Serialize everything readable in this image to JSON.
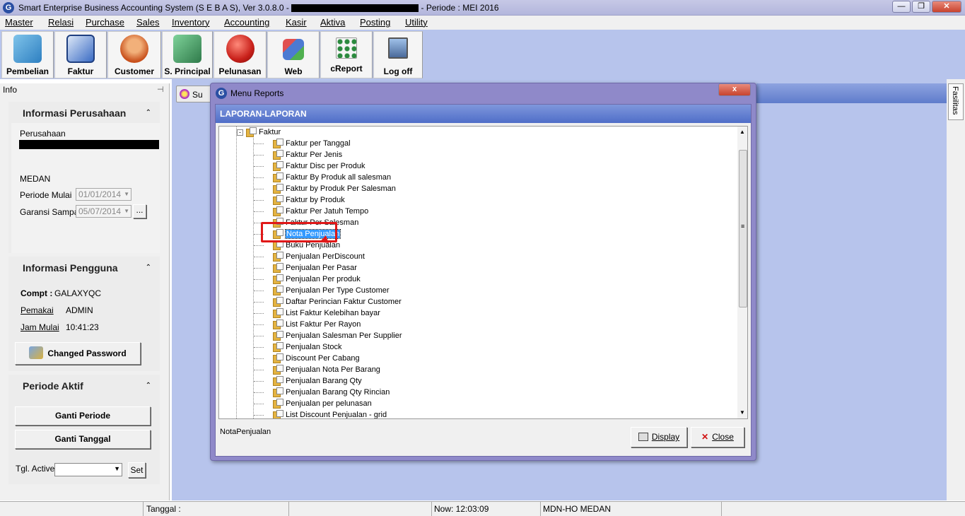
{
  "window": {
    "title_prefix": "Smart Enterprise Business Accounting System (S E B A S), Ver 3.0.8.0 -",
    "title_suffix": "- Periode : MEI  2016",
    "app_icon": "G"
  },
  "menu": [
    "Master",
    "Relasi",
    "Purchase",
    "Sales",
    "Inventory",
    "Accounting",
    "Kasir",
    "Aktiva",
    "Posting",
    "Utility"
  ],
  "toolbar": [
    {
      "label": "Pembelian",
      "icon": "building-chart-icon",
      "color": "#4aa3d8"
    },
    {
      "label": "Faktur",
      "icon": "invoice-icon",
      "color": "#3b6cc4"
    },
    {
      "label": "Customer",
      "icon": "headset-person-icon",
      "color": "#d2642a"
    },
    {
      "label": "S. Principal",
      "icon": "money-icon",
      "color": "#3c9a5a"
    },
    {
      "label": "Pelunasan",
      "icon": "red-globe-icon",
      "color": "#c8201a"
    },
    {
      "label": "Web",
      "icon": "web-blocks-icon",
      "color": "#4c7ad2"
    },
    {
      "label": "cReport",
      "icon": "creport-icon",
      "color": "#2b8a3e"
    },
    {
      "label": "Log off",
      "icon": "computer-logoff-icon",
      "color": "#5b6c8c"
    }
  ],
  "sidebar": {
    "header": "Info",
    "company": {
      "title": "Informasi Perusahaan",
      "label": "Perusahaan",
      "city": "MEDAN",
      "periode_mulai_label": "Periode Mulai",
      "periode_mulai": "01/01/2014",
      "garansi_label": "Garansi Sampai",
      "garansi": "05/07/2014",
      "browse": "..."
    },
    "user": {
      "title": "Informasi Pengguna",
      "compt_label": "Compt :",
      "compt": "GALAXYQC",
      "pemakai_label": "Pemakai",
      "pemakai": "ADMIN",
      "jam_label": "Jam Mulai",
      "jam": "10:41:23",
      "change_pw": "Changed Password"
    },
    "periode": {
      "title": "Periode Aktif",
      "ganti_periode": "Ganti Periode",
      "ganti_tanggal": "Ganti Tanggal",
      "tgl_label": "Tgl. Active",
      "set": "Set"
    }
  },
  "background_tab": "Su",
  "right_tab": "Fasilitas",
  "dialog": {
    "title": "Menu Reports",
    "header": "LAPORAN-LAPORAN",
    "root": "Faktur",
    "items": [
      "Faktur per Tanggal",
      "Faktur Per Jenis",
      "Faktur Disc per Produk",
      "Faktur By Produk all salesman",
      "Faktur by Produk Per Salesman",
      "Faktur by Produk",
      "Faktur Per Jatuh Tempo",
      "Faktur Per Salesman",
      "Nota Penjualan",
      "Buku Penjualan",
      "Penjualan PerDiscount",
      "Penjualan Per Pasar",
      "Penjualan Per produk",
      "Penjualan Per Type Customer",
      "Daftar Perincian Faktur Customer",
      "List Faktur Kelebihan bayar",
      "List Faktur Per Rayon",
      "Penjualan Salesman Per Supplier",
      "Penjualan Stock",
      "Discount Per Cabang",
      "Penjualan Nota Per Barang",
      "Penjualan Barang Qty",
      "Penjualan Barang Qty Rincian",
      "Penjualan per pelunasan",
      "List Discount Penjualan - grid"
    ],
    "selected_index": 8,
    "selected_code": "NotaPenjualan",
    "display_btn": "Display",
    "close_btn": "Close",
    "close_x": "x"
  },
  "status": {
    "tanggal": "Tanggal :",
    "now": "Now: 12:03:09",
    "location": "MDN-HO MEDAN"
  },
  "colors": {
    "accent": "#4f6ec8",
    "highlight": "#e01818",
    "selection": "#3399ff"
  }
}
